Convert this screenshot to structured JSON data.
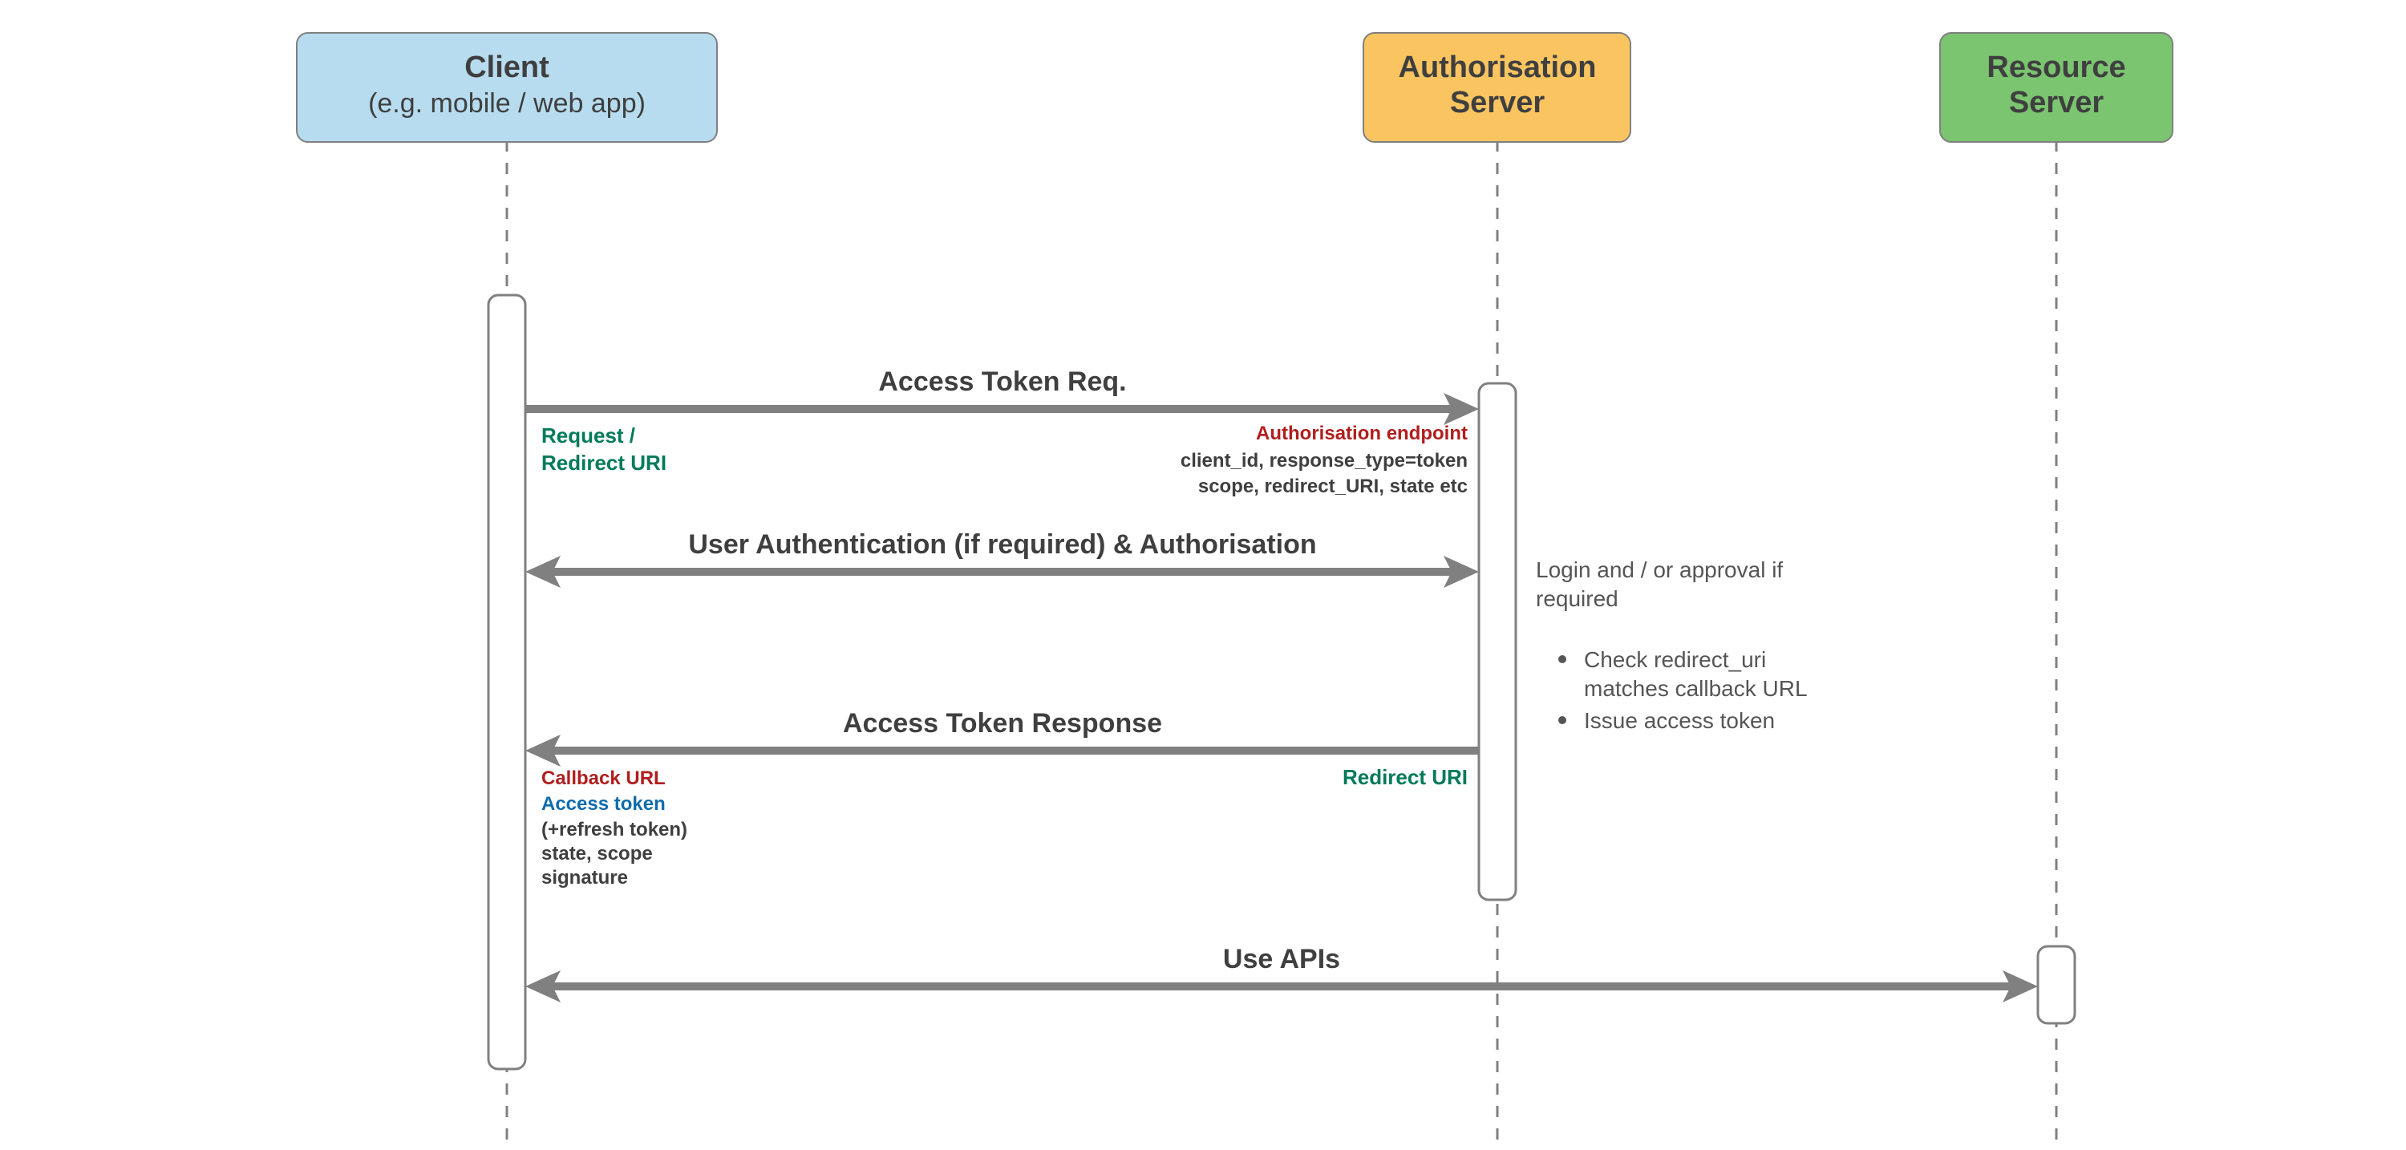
{
  "participants": {
    "client": {
      "title": "Client",
      "subtitle": "(e.g. mobile / web app)",
      "fill": "#b7dcef"
    },
    "auth": {
      "title": "Authorisation",
      "subtitle": "Server",
      "fill": "#fac561"
    },
    "res": {
      "title": "Resource",
      "subtitle": "Server",
      "fill": "#7bc470"
    }
  },
  "messages": {
    "m1": {
      "label": "Access Token Req.",
      "left_note_line1": "Request /",
      "left_note_line2": "Redirect URI",
      "right_note_title": "Authorisation endpoint",
      "right_note_line1": "client_id, response_type=token",
      "right_note_line2": "scope, redirect_URI, state etc"
    },
    "m2": {
      "label": "User Authentication (if required) & Authorisation"
    },
    "m3": {
      "label": "Access Token Response",
      "right_note": "Redirect URI",
      "left_note_title": "Callback URL",
      "left_note_token": "Access token",
      "left_note_line1": "(+refresh token)",
      "left_note_line2": "state, scope",
      "left_note_line3": "signature"
    },
    "m4": {
      "label": "Use APIs"
    }
  },
  "side_note": {
    "line1": "Login and / or approval if",
    "line2": "required",
    "bullet1": "Check redirect_uri",
    "bullet1b": "matches callback URL",
    "bullet2": "Issue access token"
  }
}
